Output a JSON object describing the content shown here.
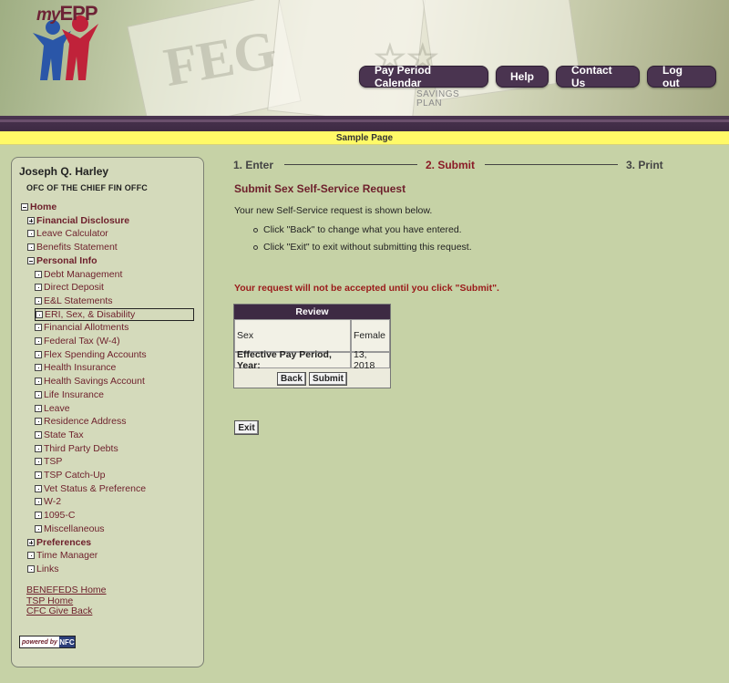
{
  "header": {
    "logo_my": "my",
    "logo_epp": "EPP",
    "savings_line1": "SAVINGS",
    "savings_line2": "PLAN",
    "nav": [
      {
        "label": "Pay Period Calendar"
      },
      {
        "label": "Help"
      },
      {
        "label": "Contact Us"
      },
      {
        "label": "Log out"
      }
    ],
    "sample_bar": "Sample Page"
  },
  "sidebar": {
    "user_name": "Joseph Q. Harley",
    "office": "OFC OF THE CHIEF FIN OFFC",
    "tree": [
      {
        "label": "Home",
        "box": "minus",
        "bold": true,
        "level": 0
      },
      {
        "label": "Financial Disclosure",
        "box": "plus",
        "bold": true,
        "level": 1
      },
      {
        "label": "Leave Calculator",
        "box": "dot",
        "bold": false,
        "level": 1
      },
      {
        "label": "Benefits Statement",
        "box": "dot",
        "bold": false,
        "level": 1
      },
      {
        "label": "Personal Info",
        "box": "minus",
        "bold": true,
        "level": 1
      },
      {
        "label": "Debt Management",
        "box": "dot",
        "bold": false,
        "level": 2
      },
      {
        "label": "Direct Deposit",
        "box": "dot",
        "bold": false,
        "level": 2
      },
      {
        "label": "E&L Statements",
        "box": "dot",
        "bold": false,
        "level": 2
      },
      {
        "label": "ERI, Sex, & Disability",
        "box": "dot",
        "bold": false,
        "level": 2,
        "selected": true
      },
      {
        "label": "Financial Allotments",
        "box": "dot",
        "bold": false,
        "level": 2
      },
      {
        "label": "Federal Tax (W-4)",
        "box": "dot",
        "bold": false,
        "level": 2
      },
      {
        "label": "Flex Spending Accounts",
        "box": "dot",
        "bold": false,
        "level": 2
      },
      {
        "label": "Health Insurance",
        "box": "dot",
        "bold": false,
        "level": 2
      },
      {
        "label": "Health Savings Account",
        "box": "dot",
        "bold": false,
        "level": 2
      },
      {
        "label": "Life Insurance",
        "box": "dot",
        "bold": false,
        "level": 2
      },
      {
        "label": "Leave",
        "box": "dot",
        "bold": false,
        "level": 2
      },
      {
        "label": "Residence Address",
        "box": "dot",
        "bold": false,
        "level": 2
      },
      {
        "label": "State Tax",
        "box": "dot",
        "bold": false,
        "level": 2
      },
      {
        "label": "Third Party Debts",
        "box": "dot",
        "bold": false,
        "level": 2
      },
      {
        "label": "TSP",
        "box": "dot",
        "bold": false,
        "level": 2
      },
      {
        "label": "TSP Catch-Up",
        "box": "dot",
        "bold": false,
        "level": 2
      },
      {
        "label": "Vet Status & Preference",
        "box": "dot",
        "bold": false,
        "level": 2
      },
      {
        "label": "W-2",
        "box": "dot",
        "bold": false,
        "level": 2
      },
      {
        "label": "1095-C",
        "box": "dot",
        "bold": false,
        "level": 2
      },
      {
        "label": "Miscellaneous",
        "box": "dot",
        "bold": false,
        "level": 2
      },
      {
        "label": "Preferences",
        "box": "plus",
        "bold": true,
        "level": 1
      },
      {
        "label": "Time Manager",
        "box": "dot",
        "bold": false,
        "level": 1
      },
      {
        "label": "Links",
        "box": "dot",
        "bold": false,
        "level": 1
      }
    ],
    "links": [
      {
        "label": "BENEFEDS Home"
      },
      {
        "label": "TSP Home"
      },
      {
        "label": "CFC Give Back"
      }
    ],
    "powered_by": "powered by",
    "powered_logo": "NFC"
  },
  "main": {
    "steps": [
      {
        "label": "1. Enter",
        "active": false
      },
      {
        "label": "2. Submit",
        "active": true
      },
      {
        "label": "3. Print",
        "active": false
      }
    ],
    "title": "Submit Sex Self-Service Request",
    "intro": "Your new Self-Service request is shown below.",
    "bullets": [
      "Click \"Back\" to change what you have entered.",
      "Click \"Exit\" to exit without submitting this request."
    ],
    "warning": "Your request will not be accepted until you click \"Submit\".",
    "review": {
      "header": "Review",
      "rows": [
        {
          "label": "Sex",
          "value": "Female"
        },
        {
          "label": "Effective Pay Period, Year:",
          "value": "13, 2018"
        }
      ],
      "back_label": "Back",
      "submit_label": "Submit"
    },
    "exit_label": "Exit"
  }
}
